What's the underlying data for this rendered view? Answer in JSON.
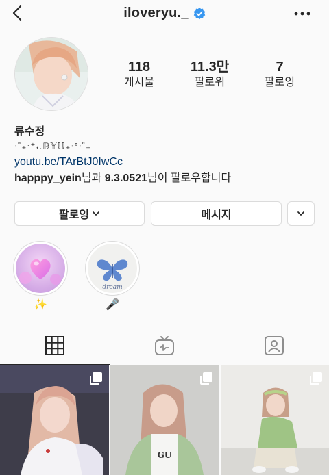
{
  "header": {
    "username": "iloveryu._"
  },
  "stats": {
    "posts": {
      "value": "118",
      "label": "게시물"
    },
    "followers": {
      "value": "11.3만",
      "label": "팔로워"
    },
    "following": {
      "value": "7",
      "label": "팔로잉"
    }
  },
  "bio": {
    "name": "류수정",
    "deco": "⋅˚₊‧⁺˖.ℝ𝕐𝕌₊⋅°⋅˚₊",
    "link": "youtu.be/TArBtJ0IwCc",
    "mutual_prefix_user": "happpy_yein",
    "mutual_mid": "님과 ",
    "mutual_user2": "9.3.0521",
    "mutual_suffix": "님이 팔로우합니다"
  },
  "buttons": {
    "following_label": "팔로잉",
    "message_label": "메시지"
  },
  "highlights": [
    {
      "label": "✨",
      "icon": "pink-heart"
    },
    {
      "label": "🎤",
      "icon": "blue-butterfly-dream"
    }
  ],
  "tabs": [
    {
      "name": "grid",
      "icon": "grid-icon",
      "active": true
    },
    {
      "name": "igtv",
      "icon": "igtv-icon",
      "active": false
    },
    {
      "name": "tagged",
      "icon": "tagged-icon",
      "active": false
    }
  ],
  "colors": {
    "verified": "#3897f0",
    "link": "#003569",
    "border": "#dbdbdb"
  }
}
